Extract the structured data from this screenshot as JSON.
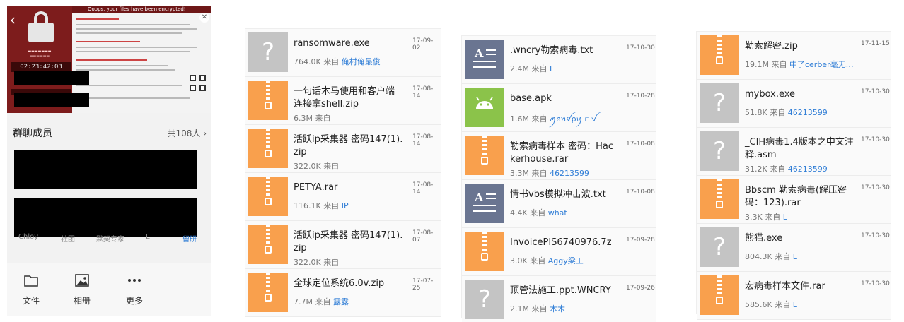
{
  "panel1": {
    "ransom_title": "Ooops, your files have been encrypted!",
    "members_title": "群聊成员",
    "members_count": "共108人",
    "avatar_names": [
      "Chloy",
      "社团",
      "默契专家",
      "L",
      "留研"
    ],
    "tools": [
      {
        "label": "文件",
        "icon": "folder-icon"
      },
      {
        "label": "相册",
        "icon": "photo-album-icon"
      },
      {
        "label": "更多",
        "icon": "more-dots-icon"
      }
    ],
    "colors": {
      "accent": "#2f7dd6",
      "zip": "#f9a04d",
      "unknown": "#c4c4c4",
      "text_icon": "#6a7591",
      "apk": "#8bc34a"
    }
  },
  "list1": [
    {
      "icon": "unknown",
      "name": "ransomware.exe",
      "date": "17-09-02",
      "size": "764.0K",
      "from": "来自",
      "sender": "俺村俺最俊"
    },
    {
      "icon": "zip",
      "name": "一句话木马使用和客户端\n连接拿shell.zip",
      "date": "17-08-14",
      "size": "6.3M",
      "from": "来自",
      "sender": ""
    },
    {
      "icon": "zip",
      "name": "活跃ip采集器 密码147(1).\nzip",
      "date": "17-08-14",
      "size": "322.0K",
      "from": "来自",
      "sender": ""
    },
    {
      "icon": "zip",
      "name": "PETYA.rar",
      "date": "17-08-14",
      "size": "116.1K",
      "from": "来自",
      "sender": "IP"
    },
    {
      "icon": "zip",
      "name": "活跃ip采集器 密码147(1).\nzip",
      "date": "17-08-07",
      "size": "322.0K",
      "from": "来自",
      "sender": ""
    },
    {
      "icon": "zip",
      "name": "全球定位系统6.0v.zip",
      "date": "17-07-25",
      "size": "7.7M",
      "from": "来自",
      "sender": "露露"
    }
  ],
  "list2": [
    {
      "icon": "text",
      "name": ".wncry勒索病毒.txt",
      "date": "17-10-30",
      "size": "2.4M",
      "from": "来自",
      "sender": "L"
    },
    {
      "icon": "apk",
      "name": "base.apk",
      "date": "17-10-28",
      "size": "1.6M",
      "from": "来自",
      "sender": "ꪑꫀꪀꪤρꪗ ᥴ ꪜ"
    },
    {
      "icon": "zip",
      "name": "勒索病毒样本 密码：Hac\nkerhouse.rar",
      "date": "17-10-08",
      "size": "3.3M",
      "from": "来自",
      "sender": "46213599"
    },
    {
      "icon": "text",
      "name": "情书vbs模拟冲击波.txt",
      "date": "17-10-08",
      "size": "4.4K",
      "from": "来自",
      "sender": "what"
    },
    {
      "icon": "zip",
      "name": "InvoicePIS6740976.7z",
      "date": "17-09-28",
      "size": "3.0K",
      "from": "来自",
      "sender": "Aggy梁工"
    },
    {
      "icon": "unknown",
      "name": "顶管法施工.ppt.WNCRY",
      "date": "17-09-26",
      "size": "2.1M",
      "from": "来自",
      "sender": "木木"
    }
  ],
  "list3": [
    {
      "icon": "zip",
      "name": "勒索解密.zip",
      "date": "17-11-15",
      "size": "19.1M",
      "from": "来自",
      "sender": "中了cerber毫无…"
    },
    {
      "icon": "unknown",
      "name": "mybox.exe",
      "date": "17-10-30",
      "size": "51.8K",
      "from": "来自",
      "sender": "46213599"
    },
    {
      "icon": "unknown",
      "name": "_CIH病毒1.4版本之中文注\n释.asm",
      "date": "17-10-30",
      "size": "31.2K",
      "from": "来自",
      "sender": "46213599"
    },
    {
      "icon": "zip",
      "name": "Bbscm 勒索病毒(解压密\n码：123).rar",
      "date": "17-10-30",
      "size": "3.3K",
      "from": "来自",
      "sender": "L"
    },
    {
      "icon": "unknown",
      "name": "熊猫.exe",
      "date": "17-10-30",
      "size": "804.3K",
      "from": "来自",
      "sender": "L"
    },
    {
      "icon": "zip",
      "name": "宏病毒样本文件.rar",
      "date": "17-10-30",
      "size": "585.6K",
      "from": "来自",
      "sender": "L"
    }
  ]
}
